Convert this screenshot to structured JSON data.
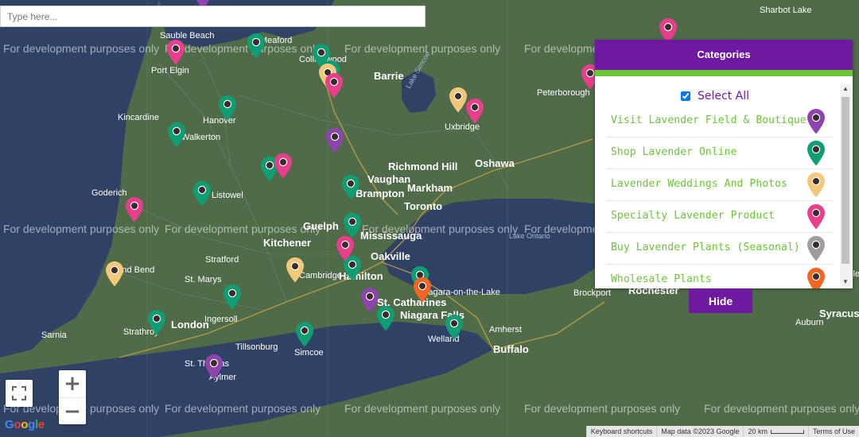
{
  "search": {
    "placeholder": "Type here..."
  },
  "categories_panel": {
    "title": "Categories",
    "select_all": {
      "label": "Select All",
      "checked": true
    },
    "items": [
      {
        "label": "Visit Lavender Field & Boutique",
        "color": "#8e44ad",
        "icon": "map-marker-icon"
      },
      {
        "label": "Shop Lavender Online",
        "color": "#0f9d74",
        "icon": "map-marker-icon"
      },
      {
        "label": "Lavender Weddings And Photos",
        "color": "#f3c87a",
        "icon": "map-marker-icon"
      },
      {
        "label": "Specialty Lavender Product",
        "color": "#e83e8c",
        "icon": "map-marker-icon"
      },
      {
        "label": "Buy Lavender Plants (Seasonal)",
        "color": "#9e9e9e",
        "icon": "map-marker-icon"
      },
      {
        "label": "Wholesale Plants",
        "color": "#f26522",
        "icon": "map-marker-icon"
      }
    ],
    "hide_button": "Hide"
  },
  "map": {
    "watermark": "For development purposes only",
    "places": [
      "Sauble Beach",
      "Meaford",
      "Collingwood",
      "Port Elgin",
      "Barrie",
      "Kincardine",
      "Hanover",
      "Walkerton",
      "Goderich",
      "Listowel",
      "Richmond Hill",
      "Oshawa",
      "Vaughan",
      "Brampton",
      "Markham",
      "Toronto",
      "Guelph",
      "Mississauga",
      "Kitchener",
      "Oakville",
      "Stratford",
      "St. Marys",
      "Hamilton",
      "Grand Bend",
      "Ingersoll",
      "London",
      "Strathroy",
      "Tillsonburg",
      "Simcoe",
      "Aylmer",
      "St. Thomas",
      "Sarnia",
      "St. Catharines",
      "Niagara Falls",
      "Niagara-on-the-Lake",
      "Welland",
      "Buffalo",
      "Amherst",
      "Peterborough",
      "Uxbridge",
      "Brockport",
      "Rochester",
      "Sharbot Lake",
      "Auburn",
      "Syracuse",
      "Baldwinsville",
      "Cambridge"
    ],
    "water_labels": [
      "Lake Simcoe",
      "Lake Ontario"
    ],
    "markers": [
      {
        "category": 0,
        "color": "#8e44ad"
      },
      {
        "category": 0,
        "color": "#8e44ad"
      },
      {
        "category": 0,
        "color": "#8e44ad"
      },
      {
        "category": 0,
        "color": "#8e44ad"
      },
      {
        "category": 1,
        "color": "#0f9d74"
      },
      {
        "category": 1,
        "color": "#0f9d74"
      },
      {
        "category": 1,
        "color": "#0f9d74"
      },
      {
        "category": 1,
        "color": "#0f9d74"
      },
      {
        "category": 1,
        "color": "#0f9d74"
      },
      {
        "category": 1,
        "color": "#0f9d74"
      },
      {
        "category": 1,
        "color": "#0f9d74"
      },
      {
        "category": 1,
        "color": "#0f9d74"
      },
      {
        "category": 1,
        "color": "#0f9d74"
      },
      {
        "category": 1,
        "color": "#0f9d74"
      },
      {
        "category": 1,
        "color": "#0f9d74"
      },
      {
        "category": 1,
        "color": "#0f9d74"
      },
      {
        "category": 1,
        "color": "#0f9d74"
      },
      {
        "category": 1,
        "color": "#0f9d74"
      },
      {
        "category": 1,
        "color": "#0f9d74"
      },
      {
        "category": 1,
        "color": "#0f9d74"
      },
      {
        "category": 2,
        "color": "#f3c87a"
      },
      {
        "category": 2,
        "color": "#f3c87a"
      },
      {
        "category": 2,
        "color": "#f3c87a"
      },
      {
        "category": 2,
        "color": "#f3c87a"
      },
      {
        "category": 3,
        "color": "#e83e8c"
      },
      {
        "category": 3,
        "color": "#e83e8c"
      },
      {
        "category": 3,
        "color": "#e83e8c"
      },
      {
        "category": 3,
        "color": "#e83e8c"
      },
      {
        "category": 3,
        "color": "#e83e8c"
      },
      {
        "category": 3,
        "color": "#e83e8c"
      },
      {
        "category": 3,
        "color": "#e83e8c"
      },
      {
        "category": 3,
        "color": "#e83e8c"
      },
      {
        "category": 5,
        "color": "#f26522"
      }
    ]
  },
  "footer": {
    "google": "Google",
    "keyboard_shortcuts": "Keyboard shortcuts",
    "map_data": "Map data ©2023 Google",
    "scale": "20 km",
    "terms": "Terms of Use"
  },
  "colors": {
    "accent_purple": "#6e1aa0",
    "accent_green": "#6bc534",
    "land": "#4f6b47",
    "water": "#2f4266"
  }
}
